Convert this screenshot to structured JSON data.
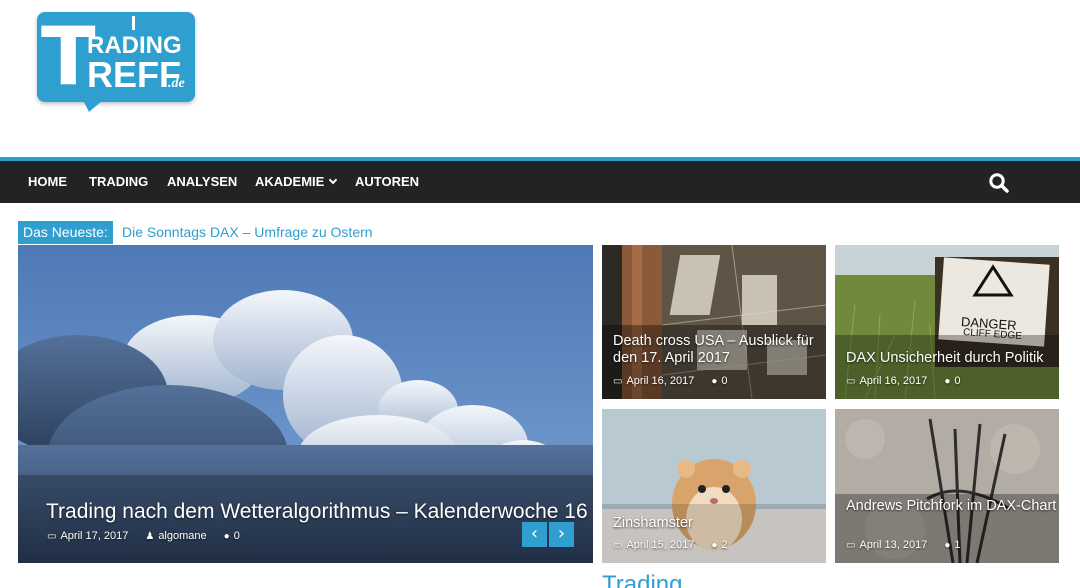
{
  "site": {
    "logo_line1": "RADING",
    "logo_line2": "REFF",
    "logo_initial": "T",
    "logo_tld": ".de"
  },
  "nav": {
    "items": [
      {
        "label": "HOME"
      },
      {
        "label": "TRADING"
      },
      {
        "label": "ANALYSEN"
      },
      {
        "label": "AKADEMIE"
      },
      {
        "label": "AUTOREN"
      }
    ]
  },
  "ticker": {
    "label": "Das Neueste:",
    "text": "Die Sonntags DAX – Umfrage zu Ostern"
  },
  "hero": {
    "title": "Trading nach dem Wetteralgorithmus – Kalenderwoche 16",
    "date": "April 17, 2017",
    "author": "algomane",
    "comments": "0"
  },
  "cards": [
    {
      "title": "Death cross USA – Ausblick für den 17. April 2017",
      "date": "April 16, 2017",
      "comments": "0"
    },
    {
      "title": "DAX Unsicherheit durch Politik",
      "date": "April 16, 2017",
      "comments": "0",
      "sign_line1": "DANGER",
      "sign_line2": "CLIFF EDGE"
    },
    {
      "title": "Zinshamster",
      "date": "April 15, 2017",
      "comments": "2"
    },
    {
      "title": "Andrews Pitchfork im DAX-Chart",
      "date": "April 13, 2017",
      "comments": "1"
    }
  ],
  "section": {
    "heading": "Trading"
  },
  "colors": {
    "accent": "#2f9fd0",
    "nav_bg": "#232323"
  }
}
